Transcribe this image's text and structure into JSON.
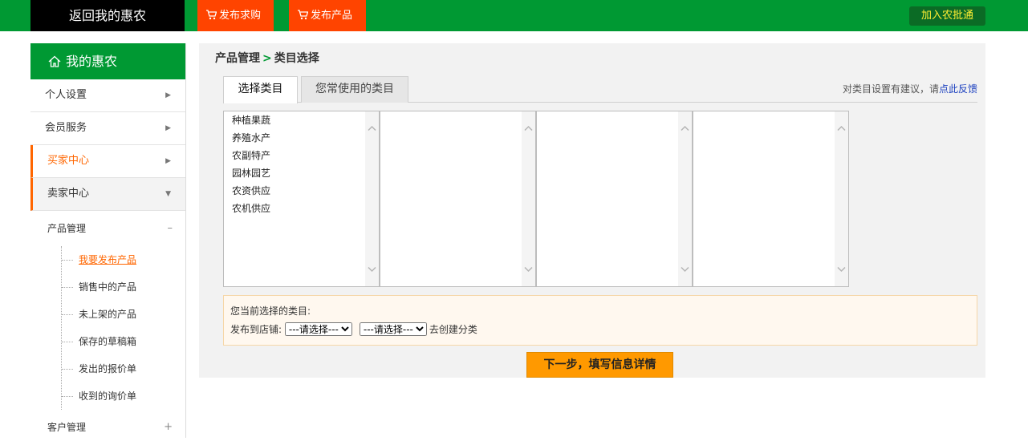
{
  "topbar": {
    "back_home": "返回我的惠农",
    "post_buy": "发布求购",
    "post_product": "发布产品",
    "join": "加入农批通"
  },
  "sidebar": {
    "title": "我的惠农",
    "items": [
      {
        "label": "个人设置"
      },
      {
        "label": "会员服务"
      },
      {
        "label": "买家中心"
      },
      {
        "label": "卖家中心"
      }
    ],
    "product_mgmt": {
      "label": "产品管理",
      "toggle": "–",
      "children": [
        "我要发布产品",
        "销售中的产品",
        "未上架的产品",
        "保存的草稿箱",
        "发出的报价单",
        "收到的询价单"
      ]
    },
    "customer_mgmt": {
      "label": "客户管理",
      "toggle": "+"
    }
  },
  "main": {
    "breadcrumb": {
      "parent": "产品管理",
      "sep": ">",
      "current": "类目选择"
    },
    "tabs": [
      "选择类目",
      "您常使用的类目"
    ],
    "suggest_text": "对类目设置有建议，请",
    "suggest_link": "点此反馈",
    "categories": [
      "种植果蔬",
      "养殖水产",
      "农副特产",
      "园林园艺",
      "农资供应",
      "农机供应"
    ],
    "selected_label": "您当前选择的类目:",
    "shop_label": "发布到店铺:",
    "select_placeholder": "---请选择---",
    "create_link": "去创建分类",
    "next_button": "下一步，填写信息详情"
  },
  "colors": {
    "brand_green": "#009933",
    "orange": "#ff4400",
    "accent": "#ff6600",
    "button": "#ff9900"
  }
}
